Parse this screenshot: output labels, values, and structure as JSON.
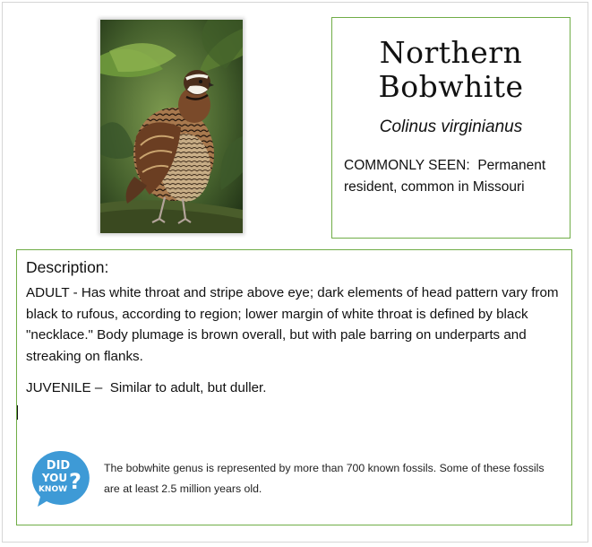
{
  "species": {
    "common_name_line1": "Northern",
    "common_name_line2": "Bobwhite",
    "scientific_name": "Colinus virginianus",
    "commonly_seen_label": "COMMONLY SEEN:",
    "commonly_seen_text": "Permanent resident, common in Missouri"
  },
  "description": {
    "heading": "Description:",
    "adult_label": "ADULT",
    "adult_text": "Has white throat and stripe above eye; dark elements of head pattern vary from black to rufous, according to region; lower margin of white throat is defined by black \"necklace.\" Body plumage is brown overall, but with pale barring on underparts and streaking on flanks.",
    "juvenile_label": "JUVENILE",
    "juvenile_text": "Similar to adult, but duller."
  },
  "did_you_know": {
    "badge_lines": [
      "DID",
      "YOU",
      "KNOW",
      "?"
    ],
    "fact": "The bobwhite genus is represented by more than 700 known fossils. Some of these fossils are at least 2.5 million years old."
  },
  "colors": {
    "box_border": "#70ad47",
    "badge_blue": "#3e9ad6",
    "page_border": "#d6d6d6"
  },
  "icons": {
    "photo": "northern-bobwhite-photo",
    "badge": "did-you-know-badge"
  }
}
